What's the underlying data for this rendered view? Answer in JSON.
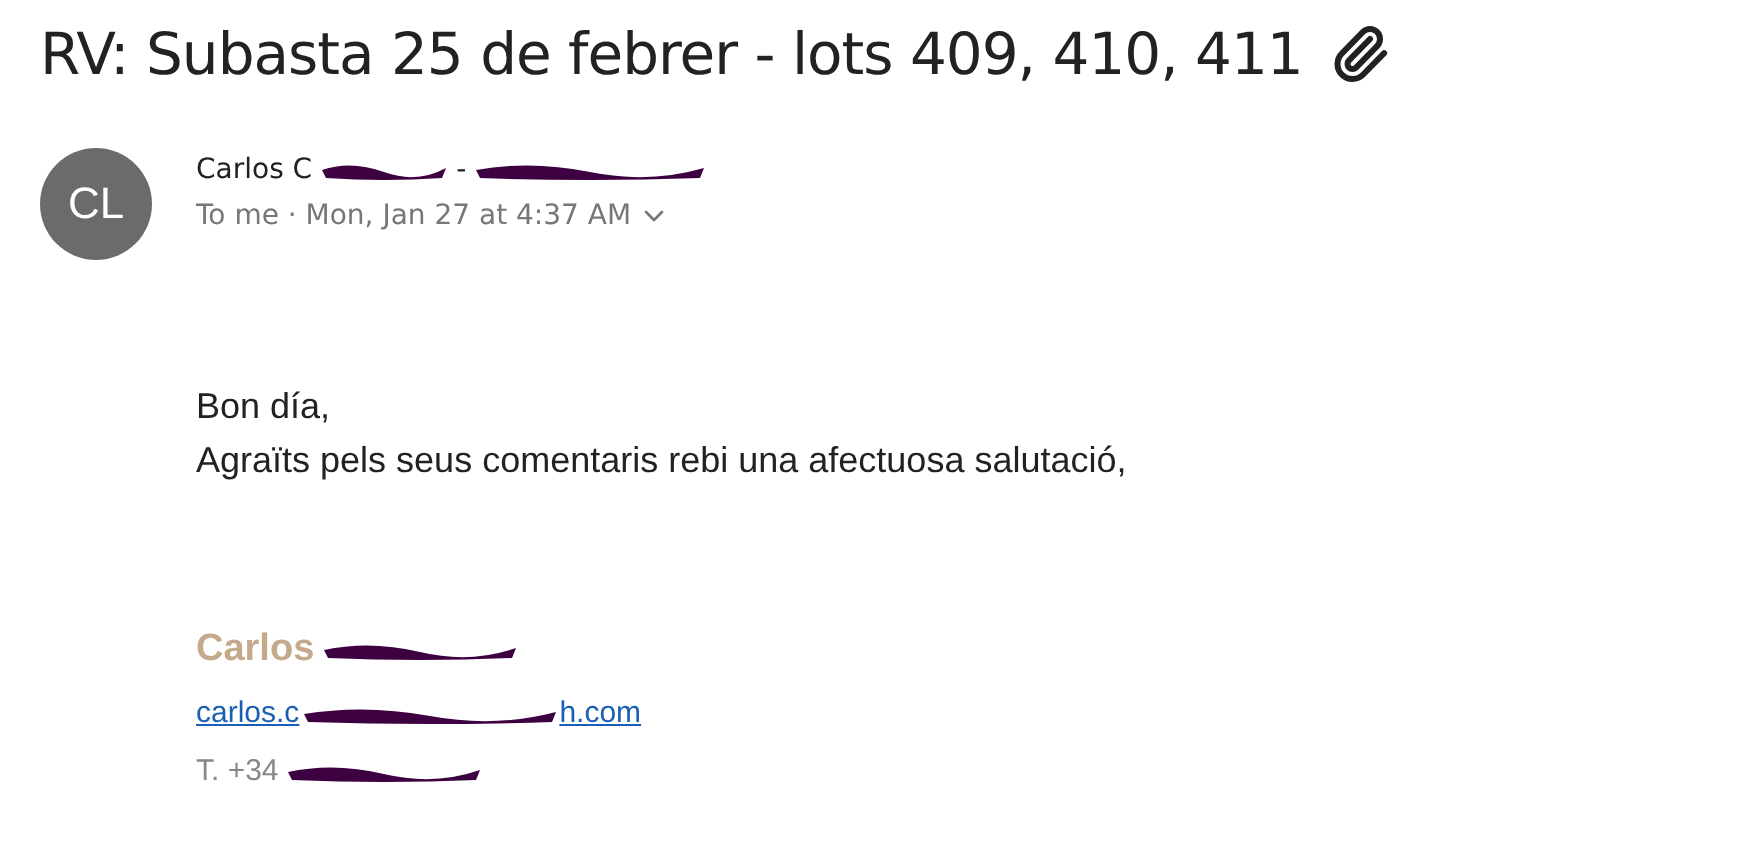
{
  "subject": "RV: Subasta 25 de febrer - lots 409, 410, 411",
  "has_attachment": true,
  "sender": {
    "initials": "CL",
    "name_parts": [
      {
        "kind": "text",
        "text": "Carlos C"
      },
      {
        "kind": "redaction"
      },
      {
        "kind": "text",
        "text": "-"
      },
      {
        "kind": "redaction"
      }
    ],
    "recipient_line": "To me · Mon, Jan 27 at 4:37 AM"
  },
  "body": [
    "Bon día,",
    "Agraïts pels seus comentaris rebi una afectuosa salutació,"
  ],
  "signature": {
    "name_parts": [
      {
        "kind": "text",
        "text": "Carlos"
      },
      {
        "kind": "redaction"
      }
    ],
    "email_parts": [
      {
        "kind": "text",
        "text": "carlos.c"
      },
      {
        "kind": "redaction"
      },
      {
        "kind": "text",
        "text": "h.com"
      }
    ],
    "phone_parts": [
      {
        "kind": "text",
        "text": "T.  +34"
      },
      {
        "kind": "redaction"
      }
    ]
  }
}
